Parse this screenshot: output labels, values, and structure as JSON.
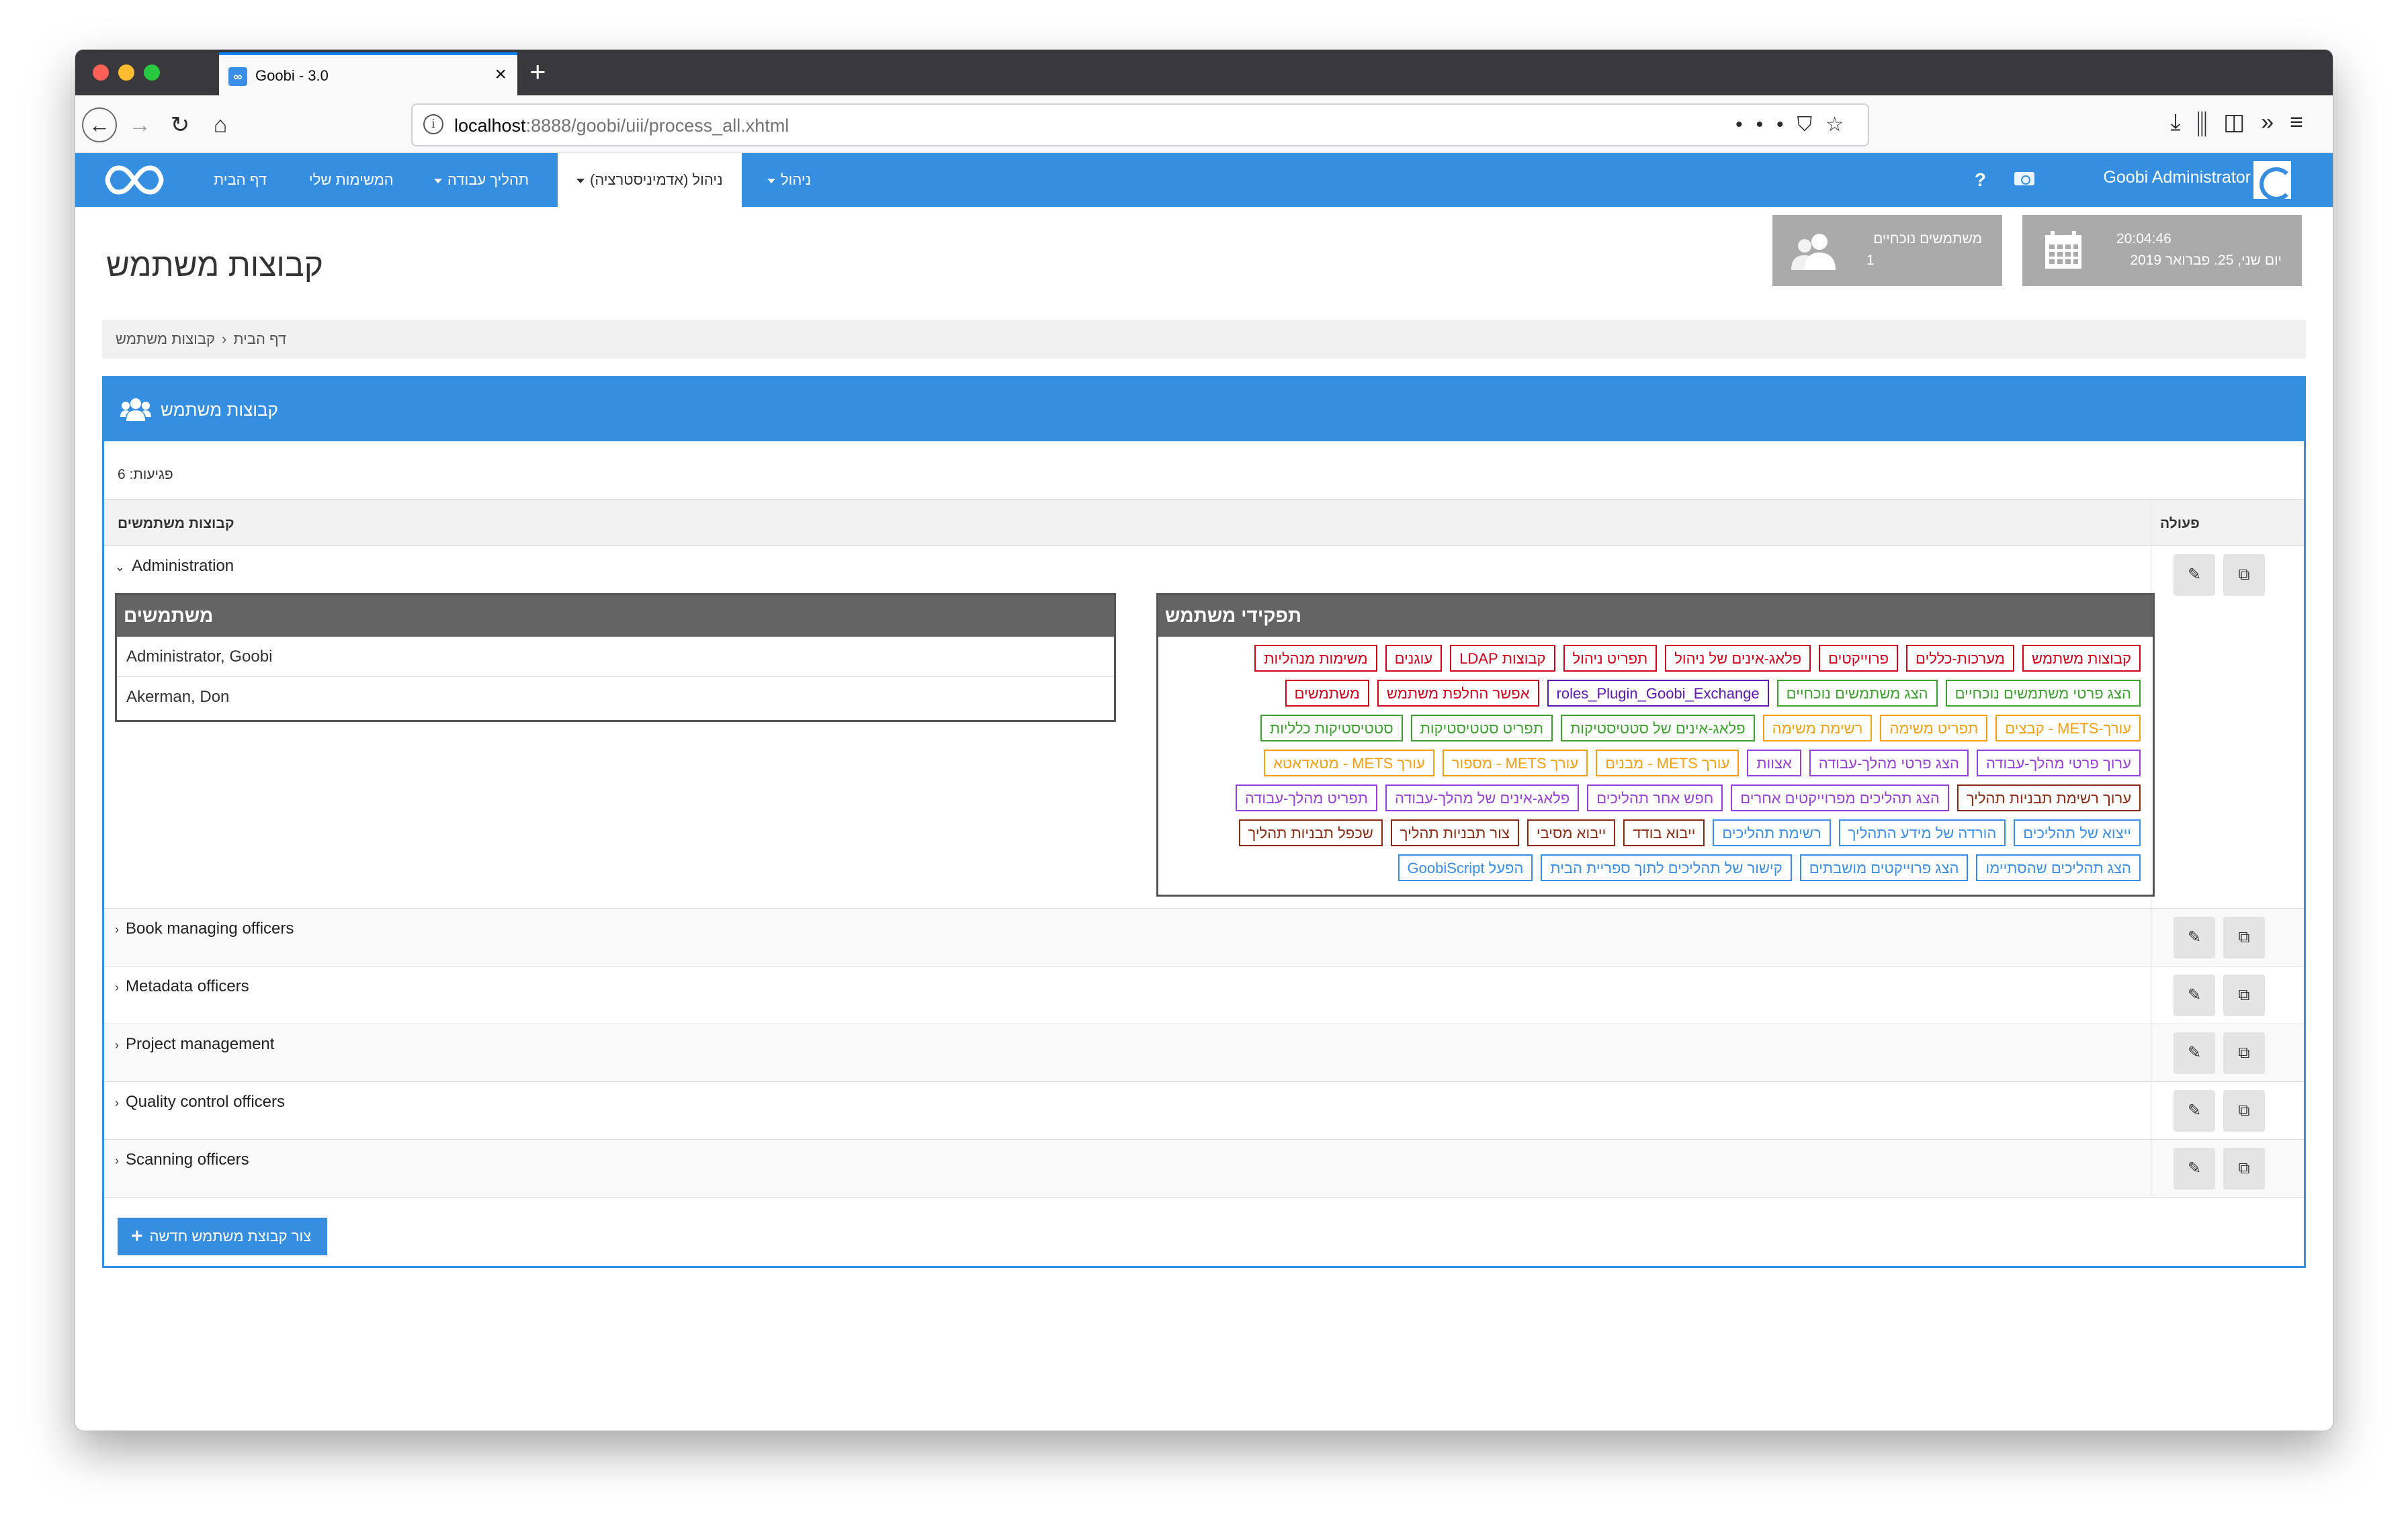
{
  "browser": {
    "tab_title": "Goobi - 3.0",
    "favicon": "∞",
    "url_host": "localhost",
    "url_rest": ":8888/goobi/uii/process_all.xhtml"
  },
  "appbar": {
    "nav": {
      "home": "דף הבית",
      "my_tasks": "המשימות שלי",
      "workflow": "תהליך עבודה",
      "admin_active": "ניהול (אדמיניסטרציה)",
      "management": "ניהול"
    },
    "help": "?",
    "user_name": "Goobi Administrator"
  },
  "page": {
    "title": "קבוצות משתמש",
    "current_users_title": "משתמשים נוכחיים",
    "current_users_count": "1",
    "time": "20:04:46",
    "date": "יום שני, 25. פברואר 2019"
  },
  "breadcrumb": {
    "home": "דף הבית",
    "sep": "‹",
    "current": "קבוצות משתמש"
  },
  "panel": {
    "title": "קבוצות משתמש",
    "hits": "פגיעות: 6",
    "col_groups": "קבוצות משתמשים",
    "col_action": "פעולה",
    "create_button": "צור קבוצת משתמש חדשה"
  },
  "groups": [
    {
      "name": "Administration"
    },
    {
      "name": "Book managing officers"
    },
    {
      "name": "Metadata officers"
    },
    {
      "name": "Project management"
    },
    {
      "name": "Quality control officers"
    },
    {
      "name": "Scanning officers"
    }
  ],
  "expanded": {
    "users_header": "משתמשים",
    "users": [
      "Administrator, Goobi",
      "Akerman, Don"
    ],
    "roles_header": "תפקידי משתמש"
  },
  "roles": [
    {
      "label": "קבוצות משתמש",
      "color": "#d0021b"
    },
    {
      "label": "מערכות-כללים",
      "color": "#d0021b"
    },
    {
      "label": "פרוייקטים",
      "color": "#d0021b"
    },
    {
      "label": "פלאג-אינים של ניהול",
      "color": "#d0021b"
    },
    {
      "label": "תפריט ניהול",
      "color": "#d0021b"
    },
    {
      "label": "קבוצות LDAP",
      "color": "#d0021b"
    },
    {
      "label": "עוגנים",
      "color": "#d0021b"
    },
    {
      "label": "משימות מנהליות",
      "color": "#d0021b"
    },
    {
      "label": "הצג פרטי משתמשים נוכחיים",
      "color": "#3ca12e"
    },
    {
      "label": "הצג משתמשים נוכחיים",
      "color": "#3ca12e"
    },
    {
      "label": "roles_Plugin_Goobi_Exchange",
      "color": "#5b16b3"
    },
    {
      "label": "אפשר החלפת משתמש",
      "color": "#d0021b"
    },
    {
      "label": "משתמשים",
      "color": "#d0021b"
    },
    {
      "label": "עורך-METS - קבצים",
      "color": "#f5a012"
    },
    {
      "label": "תפריט משימה",
      "color": "#f5a012"
    },
    {
      "label": "רשימת משימה",
      "color": "#f5a012"
    },
    {
      "label": "פלאג-אינים של סטטיסטיקות",
      "color": "#3ca12e"
    },
    {
      "label": "תפריט סטטיסטיקות",
      "color": "#3ca12e"
    },
    {
      "label": "סטטיסטיקות כלליות",
      "color": "#3ca12e"
    },
    {
      "label": "ערוך פרטי מהלך-עבודה",
      "color": "#9640d8"
    },
    {
      "label": "הצג פרטי מהלך-עבודה",
      "color": "#9640d8"
    },
    {
      "label": "אצוות",
      "color": "#9640d8"
    },
    {
      "label": "עורך METS - מבנים",
      "color": "#f5a012"
    },
    {
      "label": "עורך METS - מספור",
      "color": "#f5a012"
    },
    {
      "label": "עורך METS - מטאדאטא",
      "color": "#f5a012"
    },
    {
      "label": "ערוך רשימת תבניות תהליך",
      "color": "#8b2a12"
    },
    {
      "label": "הצג תהליכים מפרוייקטים אחרים",
      "color": "#9640d8"
    },
    {
      "label": "חפש אחר תהליכים",
      "color": "#9640d8"
    },
    {
      "label": "פלאג-אינים של מהלך-עבודה",
      "color": "#9640d8"
    },
    {
      "label": "תפריט מהלך-עבודה",
      "color": "#9640d8"
    },
    {
      "label": "ייצוא של תהליכים",
      "color": "#3a8ee6"
    },
    {
      "label": "הורדה של מידע התהליך",
      "color": "#3a8ee6"
    },
    {
      "label": "רשימת תהליכים",
      "color": "#3a8ee6"
    },
    {
      "label": "ייבוא בודד",
      "color": "#8b2a12"
    },
    {
      "label": "ייבוא מסיבי",
      "color": "#8b2a12"
    },
    {
      "label": "צור תבניות תהליך",
      "color": "#8b2a12"
    },
    {
      "label": "שכפל תבניות תהליך",
      "color": "#8b2a12"
    },
    {
      "label": "הצג תהליכים שהסתיימו",
      "color": "#3a8ee6"
    },
    {
      "label": "הצג פרוייקטים מושבתים",
      "color": "#3a8ee6"
    },
    {
      "label": "קישור של תהליכים לתוך ספריית הבית",
      "color": "#3a8ee6"
    },
    {
      "label": "הפעל GoobiScript",
      "color": "#3a8ee6"
    }
  ],
  "colors": {
    "primary": "#368ee0",
    "stat_box": "#aaaaaa",
    "sub_header": "#646464"
  }
}
